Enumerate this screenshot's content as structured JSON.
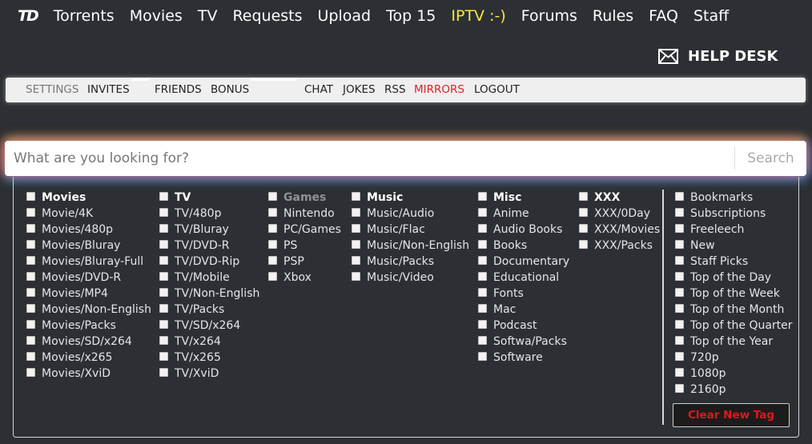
{
  "logo": "TD",
  "nav": [
    "Torrents",
    "Movies",
    "TV",
    "Requests",
    "Upload",
    "Top 15",
    "IPTV :-)",
    "Forums",
    "Rules",
    "FAQ",
    "Staff"
  ],
  "helpdesk": {
    "label": "HELP DESK",
    "icon": "envelope-icon"
  },
  "subnav": [
    "SETTINGS",
    "INVITES",
    "FRIENDS",
    "BONUS",
    "CHAT",
    "JOKES",
    "RSS",
    "MIRRORS",
    "LOGOUT"
  ],
  "search": {
    "placeholder": "What are you looking for?",
    "button": "Search"
  },
  "categories": [
    {
      "head": "Movies",
      "items": [
        "Movie/4K",
        "Movies/480p",
        "Movies/Bluray",
        "Movies/Bluray-Full",
        "Movies/DVD-R",
        "Movies/MP4",
        "Movies/Non-English",
        "Movies/Packs",
        "Movies/SD/x264",
        "Movies/x265",
        "Movies/XviD"
      ]
    },
    {
      "head": "TV",
      "items": [
        "TV/480p",
        "TV/Bluray",
        "TV/DVD-R",
        "TV/DVD-Rip",
        "TV/Mobile",
        "TV/Non-English",
        "TV/Packs",
        "TV/SD/x264",
        "TV/x264",
        "TV/x265",
        "TV/XviD"
      ]
    },
    {
      "head": "Games",
      "items": [
        "Nintendo",
        "PC/Games",
        "PS",
        "PSP",
        "Xbox"
      ]
    },
    {
      "head": "Music",
      "items": [
        "Music/Audio",
        "Music/Flac",
        "Music/Non-English",
        "Music/Packs",
        "Music/Video"
      ]
    },
    {
      "head": "Misc",
      "items": [
        "Anime",
        "Audio Books",
        "Books",
        "Documentary",
        "Educational",
        "Fonts",
        "Mac",
        "Podcast",
        "Softwa/Packs",
        "Software"
      ]
    },
    {
      "head": "XXX",
      "items": [
        "XXX/0Day",
        "XXX/Movies",
        "XXX/Packs"
      ]
    }
  ],
  "filters": [
    "Bookmarks",
    "Subscriptions",
    "Freeleech",
    "New",
    "Staff Picks",
    "Top of the Day",
    "Top of the Week",
    "Top of the Month",
    "Top of the Quarter",
    "Top of the Year",
    "720p",
    "1080p",
    "2160p"
  ],
  "clear_button": "Clear New Tag",
  "colors": {
    "background": "#2c2f33",
    "accent_yellow": "#f5e83a",
    "accent_red": "#e0202a"
  }
}
